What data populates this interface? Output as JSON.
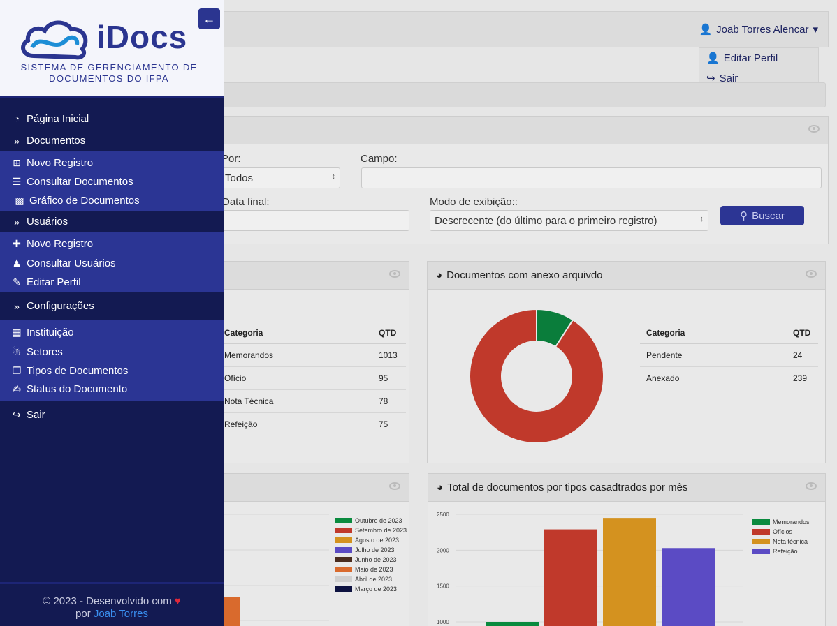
{
  "user": {
    "name": "Joab Torres Alencar",
    "menu": [
      "Editar Perfil",
      "Sair"
    ]
  },
  "filter": {
    "por_label": "Por:",
    "por_value": "Todos",
    "campo_label": "Campo:",
    "campo_value": "",
    "data_final_label": "Data final:",
    "modo_label": "Modo de exibição::",
    "modo_value": "Descrecente (do último para o primeiro registro)",
    "search_button": "Buscar"
  },
  "panel_tipos": {
    "headers": [
      "Categoria",
      "QTD"
    ],
    "rows": [
      [
        "Memorandos",
        "1013"
      ],
      [
        "Ofício",
        "95"
      ],
      [
        "Nota Técnica",
        "78"
      ],
      [
        "Refeição",
        "75"
      ]
    ]
  },
  "panel_anexo": {
    "title": "Documentos com anexo arquivdo",
    "headers": [
      "Categoria",
      "QTD"
    ],
    "rows": [
      [
        "Pendente",
        "24"
      ],
      [
        "Anexado",
        "239"
      ]
    ],
    "chart_data": {
      "type": "pie",
      "categories": [
        "Pendente",
        "Anexado"
      ],
      "values": [
        24,
        239
      ],
      "colors": [
        "#0a7d3b",
        "#c0392b"
      ]
    }
  },
  "panel_mes": {
    "legend": [
      {
        "label": "Outubro de 2023",
        "color": "#0a8a3e"
      },
      {
        "label": "Setembro de 2023",
        "color": "#c0392b"
      },
      {
        "label": "Agosto de 2023",
        "color": "#d4921f"
      },
      {
        "label": "Julho de 2023",
        "color": "#5b4bc4"
      },
      {
        "label": "Junho de 2023",
        "color": "#4a2c1e"
      },
      {
        "label": "Maio de 2023",
        "color": "#d96a2d"
      },
      {
        "label": "Abril de 2023",
        "color": "#cfcfcf"
      },
      {
        "label": "Março de 2023",
        "color": "#0d1240"
      }
    ]
  },
  "panel_tipos_mes": {
    "title": "Total de documentos por tipos casadtrados por mês",
    "chart_data": {
      "type": "bar",
      "categories": [
        "Memorandos",
        "Ofícios",
        "Nota técnica",
        "Refeição"
      ],
      "values": [
        1000,
        2290,
        2450,
        2030
      ],
      "colors": [
        "#0a8a3e",
        "#c0392b",
        "#d4921f",
        "#5b4bc4"
      ],
      "yticks": [
        "2500",
        "2000",
        "1500",
        "1000"
      ],
      "ylim": [
        1000,
        2500
      ]
    }
  },
  "sidebar": {
    "brand": "iDocs",
    "tagline_1": "SISTEMA DE GERENCIAMENTO DE",
    "tagline_2": "DOCUMENTOS DO IFPA",
    "home": "Página Inicial",
    "documentos": "Documentos",
    "doc_items": [
      "Novo Registro",
      "Consultar Documentos",
      "Gráfico de Documentos"
    ],
    "usuarios": "Usuários",
    "user_items": [
      "Novo Registro",
      "Consultar Usuários",
      "Editar Perfil"
    ],
    "config": "Configurações",
    "config_items": [
      "Instituição",
      "Setores",
      "Tipos de Documentos",
      "Status do Documento"
    ],
    "sair": "Sair"
  },
  "footer": {
    "line1": "2023 - Desenvolvido com",
    "by": "por",
    "author": "Joab Torres"
  }
}
